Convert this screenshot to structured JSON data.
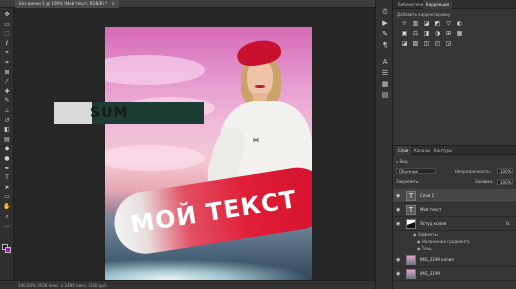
{
  "document_tab": {
    "title": "Без имени-1 @ 100% (Мой текст, RGB/8) *",
    "close": "×"
  },
  "tools": [
    {
      "name": "move-tool",
      "glyph": "✥"
    },
    {
      "name": "artboard-tool",
      "glyph": "▭"
    },
    {
      "name": "marquee-tool",
      "glyph": "⬚"
    },
    {
      "name": "lasso-tool",
      "glyph": "ℓ"
    },
    {
      "name": "quick-select-tool",
      "glyph": "⌖"
    },
    {
      "name": "crop-tool",
      "glyph": "⌗"
    },
    {
      "name": "frame-tool",
      "glyph": "⊠"
    },
    {
      "name": "eyedropper-tool",
      "glyph": "⁄"
    },
    {
      "name": "healing-brush-tool",
      "glyph": "✚"
    },
    {
      "name": "brush-tool",
      "glyph": "✎"
    },
    {
      "name": "stamp-tool",
      "glyph": "⊥"
    },
    {
      "name": "history-brush-tool",
      "glyph": "↺"
    },
    {
      "name": "eraser-tool",
      "glyph": "◧"
    },
    {
      "name": "gradient-tool",
      "glyph": "▤"
    },
    {
      "name": "blur-tool",
      "glyph": "◆"
    },
    {
      "name": "dodge-tool",
      "glyph": "●"
    },
    {
      "name": "pen-tool",
      "glyph": "✒"
    },
    {
      "name": "type-tool",
      "glyph": "T"
    },
    {
      "name": "path-select-tool",
      "glyph": "➤"
    },
    {
      "name": "shape-tool",
      "glyph": "▭"
    },
    {
      "name": "hand-tool",
      "glyph": "✋"
    },
    {
      "name": "zoom-tool",
      "glyph": "⌕"
    },
    {
      "name": "more-tools",
      "glyph": "…"
    }
  ],
  "colors": {
    "foreground": "#1a1a1a",
    "background": "#9a1bb3",
    "accent": "#e01e37"
  },
  "canvas": {
    "banner_text": "МОЙ ТЕКСТ",
    "stray_text": "SUM"
  },
  "status": {
    "text": "100,00%   3508 пикс. x 2480 пикс. (300 ppi)"
  },
  "right_strip": [
    {
      "name": "history-icon",
      "glyph": "⏱"
    },
    {
      "name": "actions-icon",
      "glyph": "▶"
    },
    {
      "name": "brush-settings-icon",
      "glyph": "✎"
    },
    {
      "name": "paragraph-icon",
      "glyph": "¶"
    },
    {
      "name": "character-icon",
      "glyph": "A"
    },
    {
      "name": "properties-icon",
      "glyph": "☰"
    },
    {
      "name": "swatches-icon",
      "glyph": "▦"
    },
    {
      "name": "gradients-icon",
      "glyph": "▤"
    }
  ],
  "adjustments": {
    "tabs": [
      "Библиотеки",
      "Коррекция"
    ],
    "title": "Добавить корректировку",
    "icons": [
      "☼",
      "▥",
      "◪",
      "◩",
      "▽",
      "◐",
      "▣",
      "⚖",
      "◨",
      "◑",
      "⊞",
      "▦",
      "◪",
      "▧",
      "◫",
      "◰",
      "◲"
    ]
  },
  "layers": {
    "tabs": [
      "Слои",
      "Каналы",
      "Контуры"
    ],
    "filter": "Вид",
    "blend_mode": "Обычные",
    "opacity_label": "Непрозрачность:",
    "opacity_value": "100%",
    "lock_label": "Закрепить:",
    "fill_label": "Заливка:",
    "fill_value": "100%",
    "items": [
      {
        "name": "Слой 1",
        "type": "text",
        "thumb": "T"
      },
      {
        "name": "Мой текст",
        "type": "text",
        "thumb": "T"
      },
      {
        "name": "Ястуц копия",
        "type": "shape",
        "thumb": "",
        "fx": "fx"
      },
      {
        "name": "Эффекты",
        "type": "effect-header"
      },
      {
        "name": "Наложение градиента",
        "type": "effect"
      },
      {
        "name": "Тень",
        "type": "effect"
      },
      {
        "name": "IMG_2199 копия",
        "type": "image"
      },
      {
        "name": "IMG_2199",
        "type": "image"
      }
    ]
  }
}
